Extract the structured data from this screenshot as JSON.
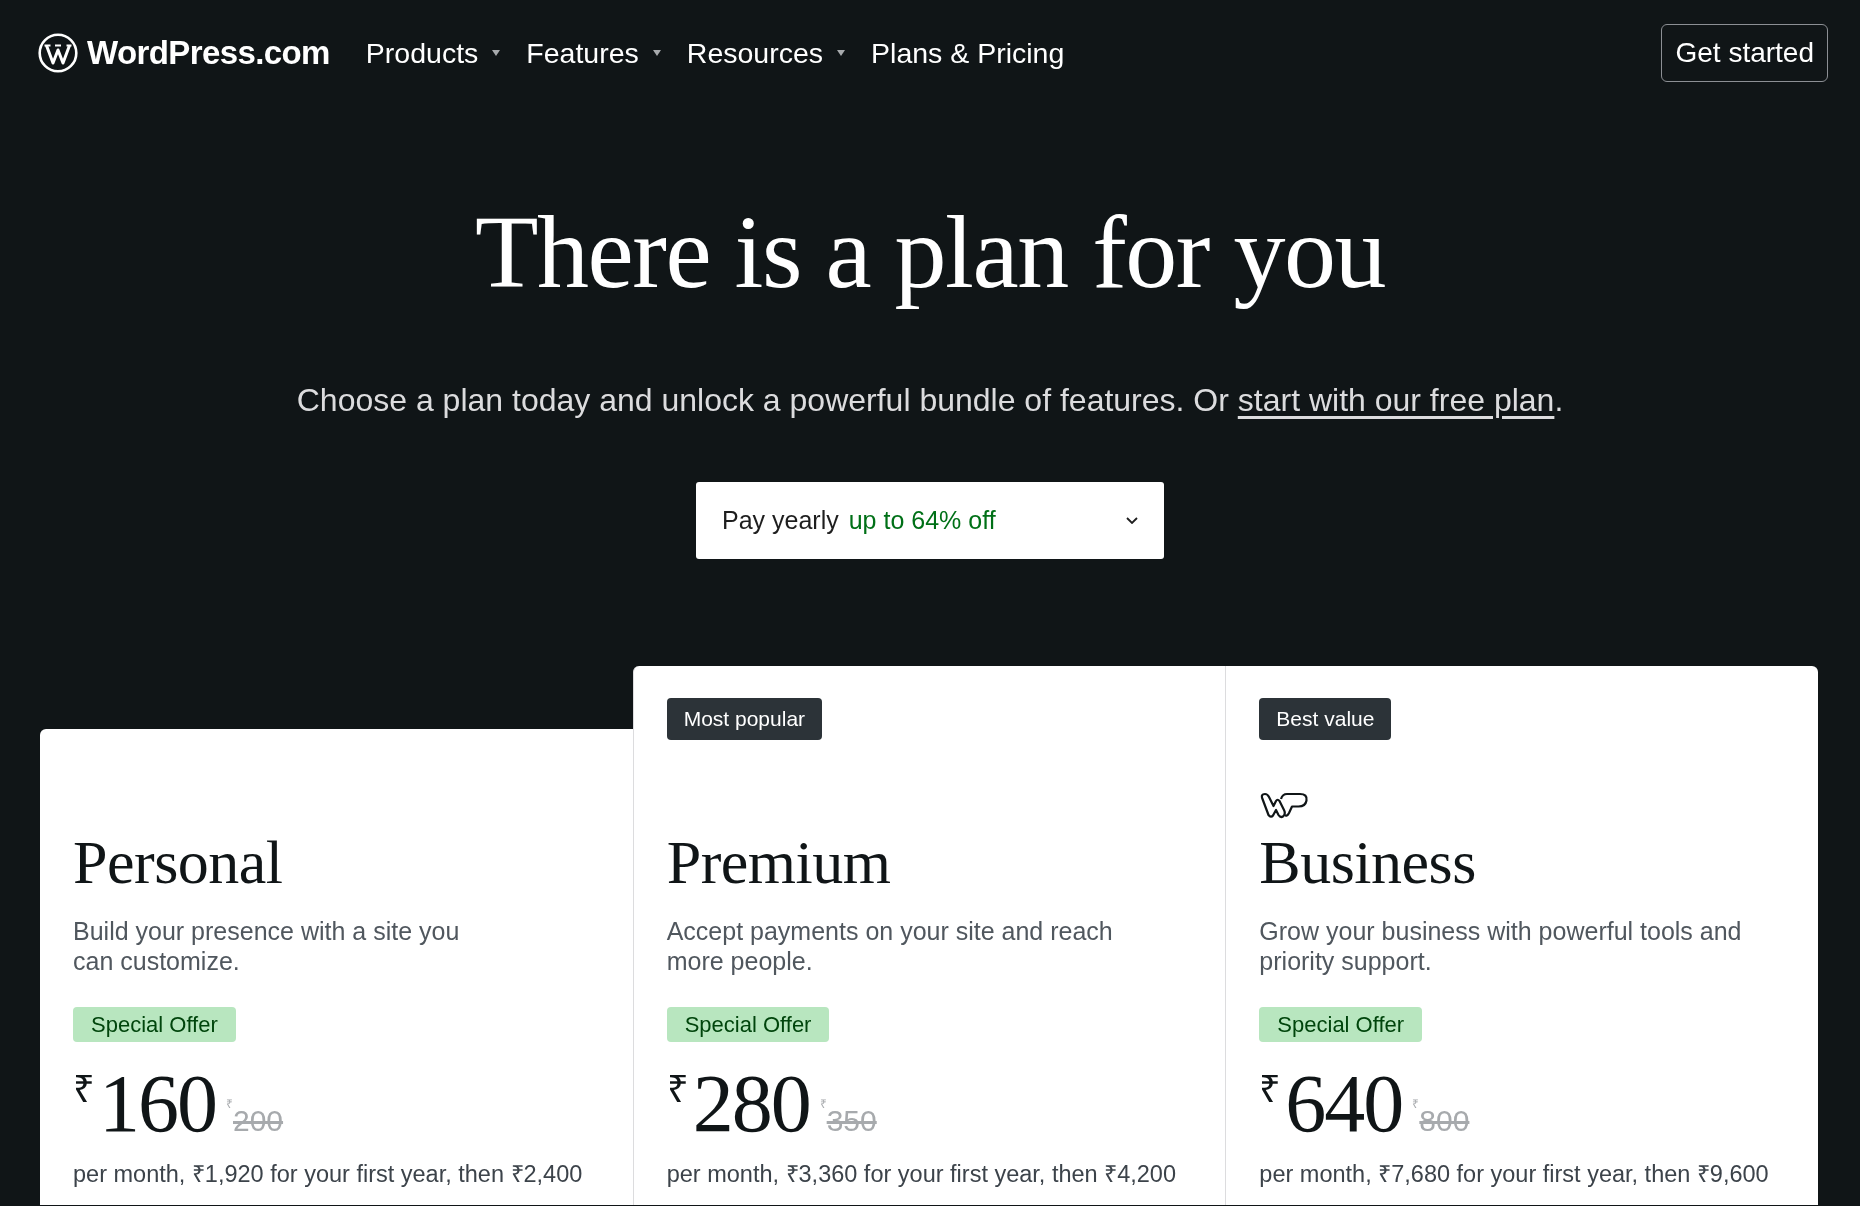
{
  "header": {
    "logo": "WordPress.com",
    "nav": [
      {
        "label": "Products",
        "dropdown": true
      },
      {
        "label": "Features",
        "dropdown": true
      },
      {
        "label": "Resources",
        "dropdown": true
      },
      {
        "label": "Plans & Pricing",
        "dropdown": false
      }
    ],
    "cta": "Get started"
  },
  "hero": {
    "title": "There is a plan for you",
    "subtitle": "Choose a plan today and unlock a powerful bundle of features. Or ",
    "subtitle_link": "start with our free plan",
    "subtitle_end": "."
  },
  "billing": {
    "label": "Pay yearly",
    "discount": "up to 64% off"
  },
  "plans": [
    {
      "name": "Personal",
      "logo": false,
      "description": "Build your presence with a site you\ncan customize.",
      "offer": "Special Offer",
      "currency": "₹",
      "price": "160",
      "original_currency": "₹",
      "original_price": "200",
      "note": "per month, ₹1,920 for your first year, then ₹2,400"
    },
    {
      "name": "Premium",
      "badge": "Most popular",
      "logo": false,
      "description": "Accept payments on your site and reach\nmore people.",
      "offer": "Special Offer",
      "currency": "₹",
      "price": "280",
      "original_currency": "₹",
      "original_price": "350",
      "note": "per month, ₹3,360 for your first year, then ₹4,200"
    },
    {
      "name": "Business",
      "badge": "Best value",
      "logo": true,
      "description": "Grow your business with powerful tools and\npriority support.",
      "offer": "Special Offer",
      "currency": "₹",
      "price": "640",
      "original_currency": "₹",
      "original_price": "800",
      "note": "per month, ₹7,680 for your first year, then ₹9,600"
    }
  ]
}
